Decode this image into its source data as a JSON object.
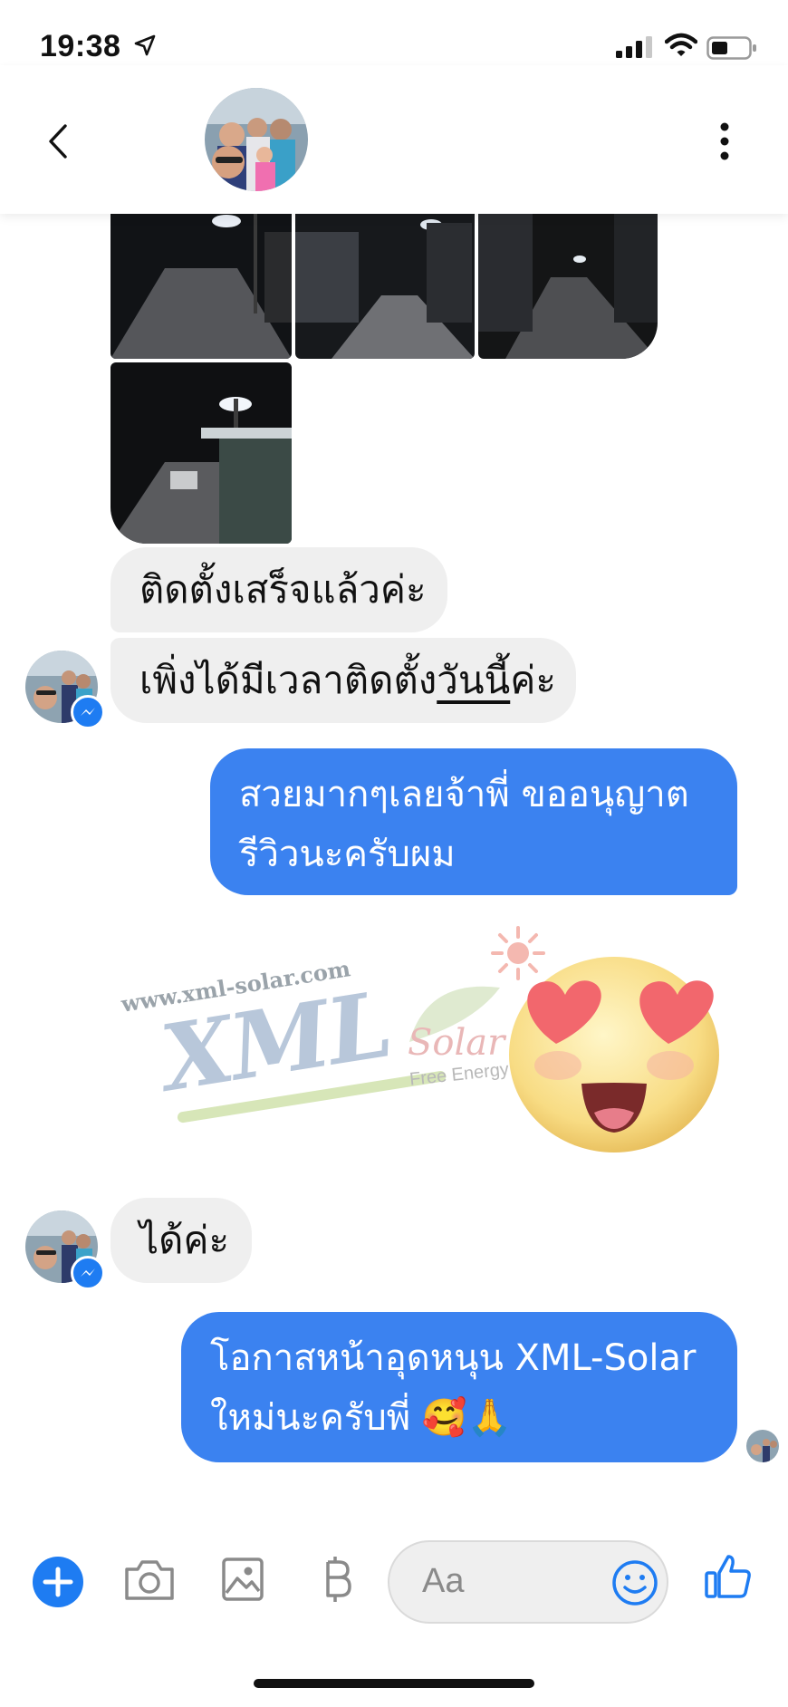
{
  "status": {
    "time": "19:38"
  },
  "chat": {
    "messages": {
      "m1": "ติดตั้งเสร็จแล้วค่ะ",
      "m2_pre": "เพิ่งได้มีเวลาติดตั้ง",
      "m2_under": "วันนี้",
      "m2_post": "ค่ะ",
      "m3_line1": "สวยมากๆเลยจ้าพี่ ขออนุญาต",
      "m3_line2": "รีวิวนะครับผม",
      "m4": "ได้ค่ะ",
      "m5_line1": "โอกาสหน้าอุดหนุน XML-Solar",
      "m5_line2": "ใหม่นะครับพี่ 🥰🙏"
    },
    "watermark": {
      "url": "www.xml-solar.com",
      "brand": "XML",
      "sub": "Solar",
      "tagline": "Free Energy",
      "mark": "®"
    }
  },
  "composer": {
    "placeholder": "Aa"
  },
  "colors": {
    "outgoing": "#3b82f0",
    "incoming": "#efefef",
    "messenger": "#1e7cf2"
  }
}
